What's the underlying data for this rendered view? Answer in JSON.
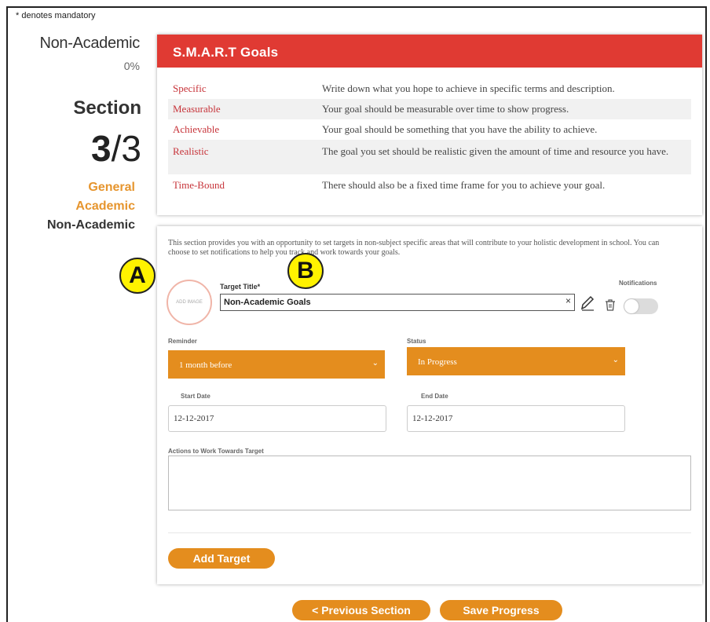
{
  "mandatory_note": "* denotes mandatory",
  "sidebar": {
    "title": "Non-Academic",
    "percent": "0%",
    "section_label": "Section",
    "section_current": "3",
    "section_total": "/3",
    "nav": [
      {
        "label": "General",
        "state": "done"
      },
      {
        "label": "Academic",
        "state": "done"
      },
      {
        "label": "Non-Academic",
        "state": "current"
      }
    ]
  },
  "smart": {
    "title": "S.M.A.R.T Goals",
    "rows": [
      {
        "term": "Specific",
        "desc": "Write down what you hope to achieve in specific terms and description."
      },
      {
        "term": "Measurable",
        "desc": "Your goal should be measurable over time to show progress."
      },
      {
        "term": "Achievable",
        "desc": "Your goal should be something that you have the ability to achieve."
      },
      {
        "term": "Realistic",
        "desc": "The goal you set should be realistic given the amount of time and resource you have."
      },
      {
        "term": "Time-Bound",
        "desc": "There should also be a fixed time frame for you to achieve your goal."
      }
    ]
  },
  "target": {
    "intro": "This section provides you with an opportunity to set targets in non-subject specific areas that will contribute to your holistic development in school. You can choose to set notifications to help you track and work towards your goals.",
    "add_image_label": "ADD IMAGE",
    "title_label": "Target Title*",
    "title_value": "Non-Academic Goals",
    "clear_symbol": "×",
    "notifications_label": "Notifications",
    "reminder_label": "Reminder",
    "reminder_value": "1 month before",
    "status_label": "Status",
    "status_value": "In Progress",
    "start_label": "Start Date",
    "start_value": "12-12-2017",
    "end_label": "End Date",
    "end_value": "12-12-2017",
    "actions_label": "Actions to Work Towards Target",
    "add_button": "Add Target"
  },
  "footer": {
    "prev_button": "< Previous Section",
    "save_button": "Save Progress"
  },
  "markers": {
    "a": "A",
    "b": "B"
  },
  "colors": {
    "accent_orange": "#e48d1e",
    "header_red": "#e03a33",
    "term_red": "#c7343a",
    "marker_yellow": "#fff200"
  }
}
